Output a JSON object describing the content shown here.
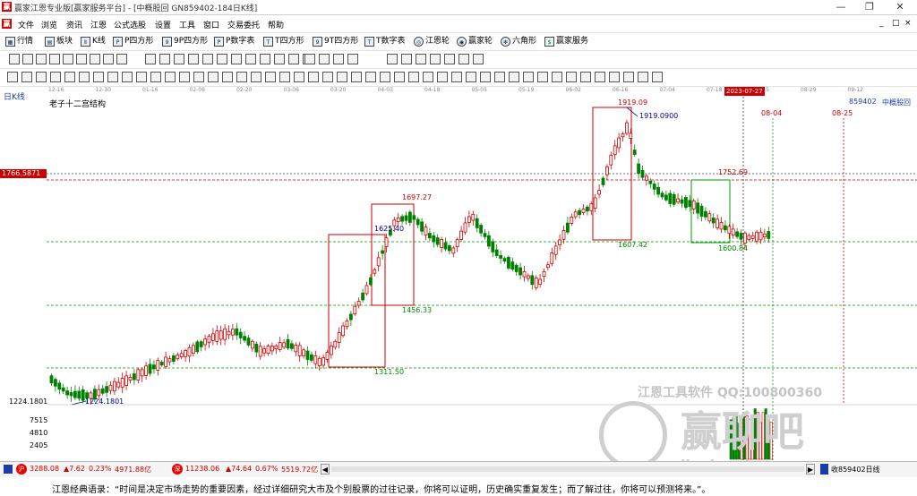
{
  "window": {
    "title": "赢家江恩专业版[赢家服务平台] - [中概股回  GN859402-184日K线]",
    "controls": [
      "—",
      "❐",
      "✕"
    ]
  },
  "menu": {
    "items": [
      "文件",
      "浏览",
      "资讯",
      "江恩",
      "公式选股",
      "设置",
      "工具",
      "窗口",
      "交易委托",
      "帮助"
    ],
    "right": [
      "_",
      "□",
      "×"
    ]
  },
  "toolbar": {
    "buttons": [
      {
        "label": "行情",
        "icon": "market-icon"
      },
      {
        "label": "板块",
        "icon": "sector-icon"
      },
      {
        "label": "K线",
        "icon": "kline-icon"
      },
      {
        "label": "P四方形",
        "icon": "p-square-icon"
      },
      {
        "label": "9P四方形",
        "icon": "9p-square-icon"
      },
      {
        "label": "P数字表",
        "icon": "p-table-icon"
      },
      {
        "label": "T四方形",
        "icon": "t-square-icon"
      },
      {
        "label": "9T四方形",
        "icon": "9t-square-icon"
      },
      {
        "label": "T数字表",
        "icon": "t-table-icon"
      },
      {
        "label": "江恩轮",
        "icon": "gann-wheel-icon"
      },
      {
        "label": "赢家轮",
        "icon": "winner-wheel-icon"
      },
      {
        "label": "六角形",
        "icon": "hexagon-icon"
      },
      {
        "label": "赢家服务",
        "icon": "service-icon"
      }
    ]
  },
  "chart_header": {
    "period_label": "日K线",
    "structure_name": "老子十二宫结构",
    "code": "859402",
    "name": "中概股回",
    "current_date": "2023-07-27",
    "future_date_1": "08-04",
    "future_date_2": "08-25"
  },
  "date_axis": [
    "12-16",
    "12-30",
    "01-16",
    "02-06",
    "02-20",
    "03-06",
    "03-20",
    "04-03",
    "04-18",
    "05-05",
    "05-19",
    "06-02",
    "06-16",
    "07-04",
    "07-18",
    "08-15",
    "08-29",
    "09-12"
  ],
  "price_labels": {
    "left_marker": "1766.5871",
    "left_low": "1224.1801",
    "low_point": "1224.1801",
    "high_peak": "1919.09",
    "high_peak_2": "1919.0900",
    "box1_low": "1311.50",
    "box2_top": "1697.27",
    "box2_mid": "1625.40",
    "box2_low": "1456.33",
    "box3_low": "1607.42",
    "box4_top": "1752.69",
    "box4_low": "1600.84"
  },
  "volume_axis": [
    "7515",
    "4810",
    "2405"
  ],
  "status": {
    "sh_index": "3288.08",
    "sh_change": "▲7.62",
    "sh_pct": "0.23%",
    "sh_amount": "4971.88亿",
    "sz_index": "11238.06",
    "sz_change": "▲74.64",
    "sz_pct": "0.67%",
    "sz_amount": "5519.72亿",
    "right_info": "收859402日线"
  },
  "quote": {
    "text": "江恩经典语录：“时间是决定市场走势的重要因素，经过详细研究大市及个别股票的过往记录，你将可以证明，历史确实重复发生；而了解过往，你将可以预测将来。”。"
  },
  "watermark": {
    "line1": "江恩工具软件  QQ:100800360",
    "big": "赢聊吧",
    "small": "liaoba.vip"
  },
  "colors": {
    "up": "#d00000",
    "down": "#008000",
    "box_red": "#cc0000",
    "box_green": "#009900",
    "label_blue": "#00008b",
    "marker_bg": "#cc0000"
  }
}
